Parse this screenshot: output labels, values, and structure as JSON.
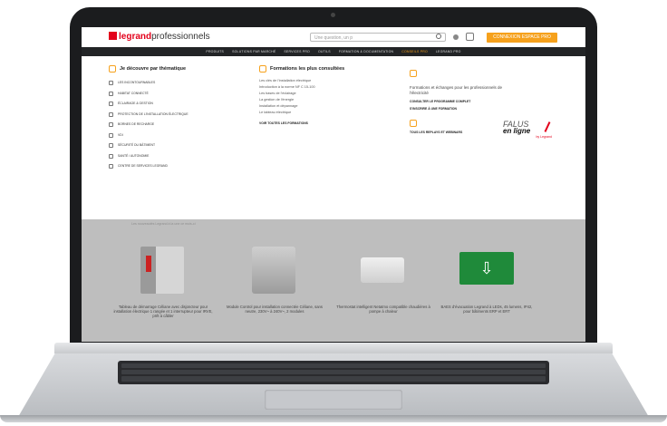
{
  "header": {
    "logo_brand": "legrand",
    "logo_suffix": "professionnels",
    "search_placeholder": "Une question, un p",
    "cta_label": "CONNEXION ESPACE PRO"
  },
  "nav": {
    "items": [
      {
        "label": "PRODUITS",
        "active": false
      },
      {
        "label": "SOLUTIONS PAR MARCHÉ",
        "active": false
      },
      {
        "label": "SERVICES PRO",
        "active": false
      },
      {
        "label": "OUTILS",
        "active": false
      },
      {
        "label": "FORMATION & DOCUMENTATION",
        "active": false
      },
      {
        "label": "CONSEILS PRO",
        "active": true
      },
      {
        "label": "LEGRAND PRO",
        "active": false
      }
    ]
  },
  "mega": {
    "col1": {
      "title": "Je découvre par thématique",
      "items": [
        "Les incontournables",
        "Habitat connecté",
        "Éclairage & gestion",
        "Protection de l'installation électrique",
        "Bornes de recharge",
        "VDI",
        "Sécurité du bâtiment",
        "Santé / Autonomie",
        "Centre de services Legrand"
      ]
    },
    "col2": {
      "title": "Formations les plus consultées",
      "lines": [
        "Les clés de l'installation électrique",
        "Introduction à la norme NF C 15-100",
        "Les bases de l'éclairage",
        "La gestion de l'énergie",
        "Installation et dépannage",
        "Le tableau électrique"
      ],
      "link": "Voir toutes les formations"
    },
    "col3": {
      "desc": "Formations et échanges pour les professionnels de l'électricité",
      "link1": "Consulter le programme complet",
      "link2": "S'inscrire à une formation",
      "link3": "Tous les replays et webinars"
    },
    "badge": {
      "top": "FALUS",
      "main": "en ligne",
      "sub": "by Legrand"
    }
  },
  "faint_text": "Les nouveautés Legrand à la une ce mois-ci",
  "products": [
    {
      "caption": "Tableau de démarrage Céliane avec disjoncteur pour installation électrique 1 rangée et 1 interrupteur pour IRVE, prêt à câbler"
    },
    {
      "caption": "Module Control pour installation connectée Céliane, sans neutre, 230V~ à 240V~, 2 modules"
    },
    {
      "caption": "Thermostat intelligent Netatmo compatible chaudières à pompe à chaleur"
    },
    {
      "caption": "BAES d'évacuation Legrand à LEDs, 45 lumens, IP42, pour bâtiments ERP et ERT"
    }
  ]
}
